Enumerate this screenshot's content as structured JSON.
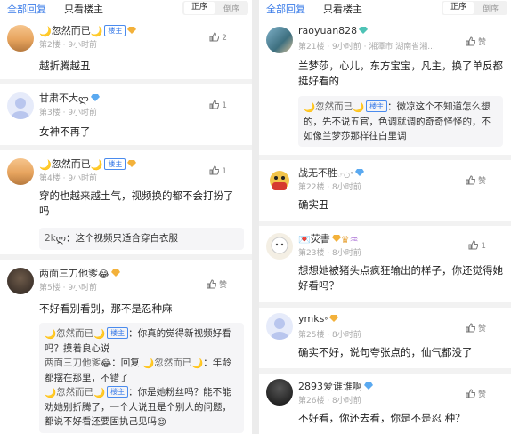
{
  "left": {
    "tabs": {
      "all": "全部回复",
      "op_only": "只看楼主"
    },
    "sort": {
      "asc": "正序",
      "desc": "倒序"
    },
    "posts": [
      {
        "name": "忽然而已",
        "badge": "楼主",
        "floor": "第2楼",
        "time": "9小时前",
        "likes": "2",
        "content": "越折腾越丑"
      },
      {
        "name": "甘肃不大",
        "floor": "第3楼",
        "time": "9小时前",
        "likes": "1",
        "content": "女神不再了"
      },
      {
        "name": "忽然而已",
        "badge": "楼主",
        "floor": "第4楼",
        "time": "9小时前",
        "likes": "1",
        "content": "穿的也越来越土气，视频换的都不会打扮了吗",
        "replies": [
          {
            "name": "2k",
            "text": "：这个视频只适合穿白衣服"
          }
        ]
      },
      {
        "name": "两面三刀他爹",
        "floor": "第5楼",
        "time": "9小时前",
        "likes": "赞",
        "content": "不好看别看别，那不是忍种麻",
        "replies": [
          {
            "name": "忽然而已",
            "badge": "楼主",
            "text": "：你真的觉得新视频好看吗？摸着良心说"
          },
          {
            "name": "两面三刀他爹",
            "text": "：回复",
            "to": "忽然而已",
            "text2": "：年龄都摆在那里，不错了"
          },
          {
            "name": "忽然而已",
            "badge": "楼主",
            "text": "：你是她粉丝吗？能不能劝她别折腾了，一个人说丑是个别人的问题，都说不好看还要固执己见吗"
          }
        ]
      }
    ]
  },
  "right": {
    "tabs": {
      "all": "全部回复",
      "op_only": "只看楼主"
    },
    "sort": {
      "asc": "正序",
      "desc": "倒序"
    },
    "posts": [
      {
        "name": "raoyuan828",
        "floor": "第21楼",
        "time": "9小时前",
        "location": "湘潭市 湖南省湘...",
        "likes": "赞",
        "content": "兰梦莎，心儿，东方宝宝，凡主，换了单反都挺好看的",
        "replies": [
          {
            "name": "忽然而已",
            "badge": "楼主",
            "text": "：微凉这个不知道怎么想的，先不说五官，色调就调的奇奇怪怪的，不如像兰梦莎那样往白里调"
          }
        ]
      },
      {
        "name": "战无不胜",
        "floor": "第22楼",
        "time": "8小时前",
        "likes": "赞",
        "content": "确实丑"
      },
      {
        "name": "荧書",
        "floor": "第23楼",
        "time": "8小时前",
        "likes": "1",
        "content": "想想她被猪头点疯狂输出的样子，你还觉得她好看吗？"
      },
      {
        "name": "ymks",
        "floor": "第25楼",
        "time": "8小时前",
        "likes": "赞",
        "content": "确实不好，说句夸张点的，仙气都没了"
      },
      {
        "name": "2893爱谁谁啊",
        "floor": "第26楼",
        "time": "8小时前",
        "likes": "赞",
        "content": "不好看，你还去看，你是不是忍 种？"
      }
    ]
  },
  "colors": {
    "accent": "#3b7ce8",
    "meta": "#aaaaaa",
    "reply_bg": "#f5f5f7"
  }
}
